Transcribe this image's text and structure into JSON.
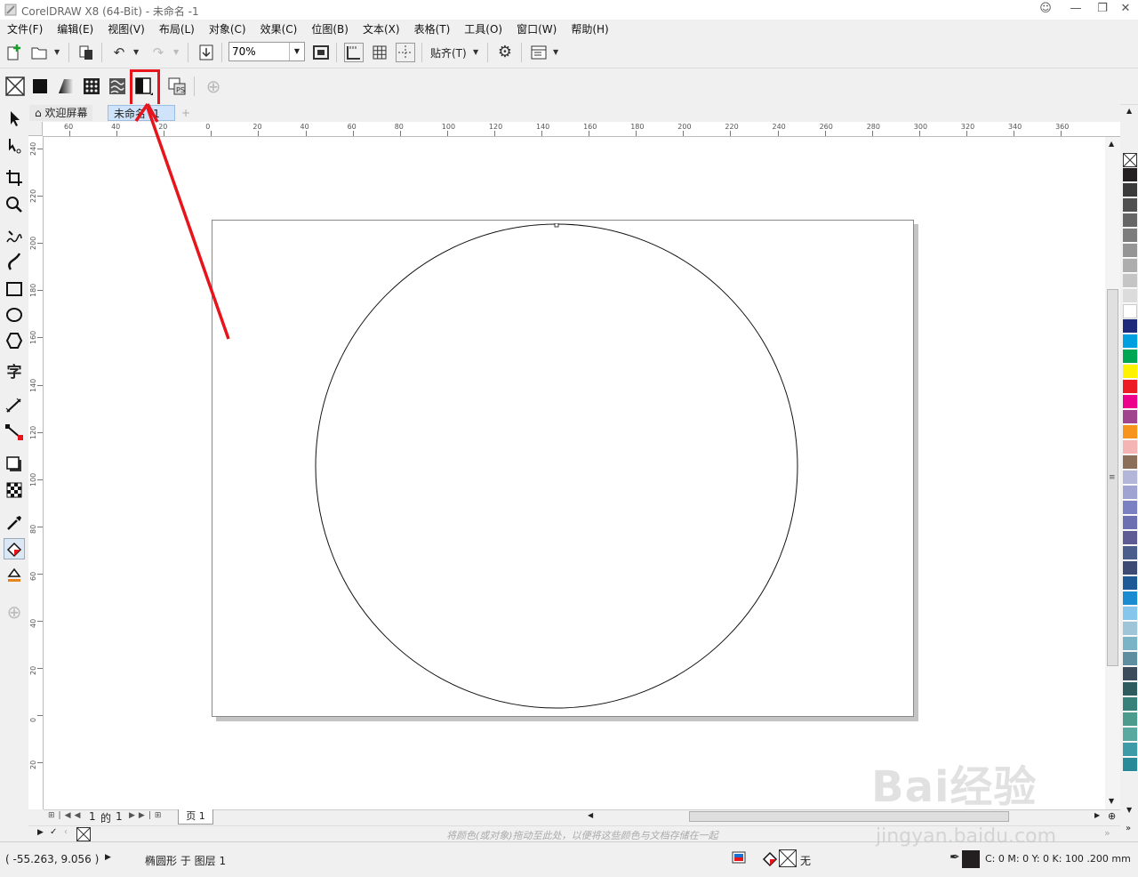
{
  "window": {
    "title": "CorelDRAW X8 (64-Bit) - 未命名 -1"
  },
  "menu": [
    "文件(F)",
    "编辑(E)",
    "视图(V)",
    "布局(L)",
    "对象(C)",
    "效果(C)",
    "位图(B)",
    "文本(X)",
    "表格(T)",
    "工具(O)",
    "窗口(W)",
    "帮助(H)"
  ],
  "toolbar": {
    "zoom_value": "70%",
    "snap_label": "贴齐(T)"
  },
  "doc_tabs": {
    "welcome": "欢迎屏幕",
    "current": "未命名 -1"
  },
  "rulers": {
    "h_labels": [
      "60",
      "40",
      "20",
      "0",
      "20",
      "40",
      "60",
      "80",
      "100",
      "120",
      "140",
      "160",
      "180",
      "200",
      "220",
      "240",
      "260",
      "280",
      "300",
      "320",
      "340",
      "360"
    ],
    "v_labels": [
      "240",
      "220",
      "200",
      "180",
      "160",
      "140",
      "120",
      "100",
      "80",
      "60",
      "40",
      "20",
      "0",
      "20"
    ]
  },
  "page_nav": {
    "current": "1",
    "of_label": "的",
    "total": "1",
    "page_tab": "页 1"
  },
  "doc_palette_hint": "将颜色(或对象)拖动至此处，以便将这些颜色与文档存储在一起",
  "status": {
    "coords": "( -55.263, 9.056 )",
    "object_info": "椭圆形 于 图层 1",
    "fill_label": "无",
    "outline_info": "C: 0 M: 0 Y: 0 K: 100 .200 mm"
  },
  "palette_colors": [
    "#231f20",
    "#3a3a3a",
    "#505050",
    "#666666",
    "#7d7d7d",
    "#959595",
    "#adadad",
    "#c5c5c5",
    "#dcdcdc",
    "#ffffff",
    "#1d2a7b",
    "#00a0e0",
    "#00a651",
    "#fff200",
    "#ed1c24",
    "#ec008c",
    "#a0448e",
    "#f7941d",
    "#f4b4b4",
    "#8b6f5a",
    "#b3b6d8",
    "#9fa3d1",
    "#7b80c3",
    "#6d6fb3",
    "#5e5a93",
    "#4a5d8c",
    "#3c4a74",
    "#1f5a96",
    "#1a8ad1",
    "#86c6ec",
    "#9ec5d8",
    "#7bb3c6",
    "#5f8ea0",
    "#3d4c5a",
    "#2e5c5e",
    "#38807a",
    "#4c9b8c",
    "#59a9a0",
    "#3d9ba7",
    "#2b8a98"
  ],
  "watermark": {
    "line1": "Bai经验",
    "line2": "jingyan.baidu.com"
  }
}
